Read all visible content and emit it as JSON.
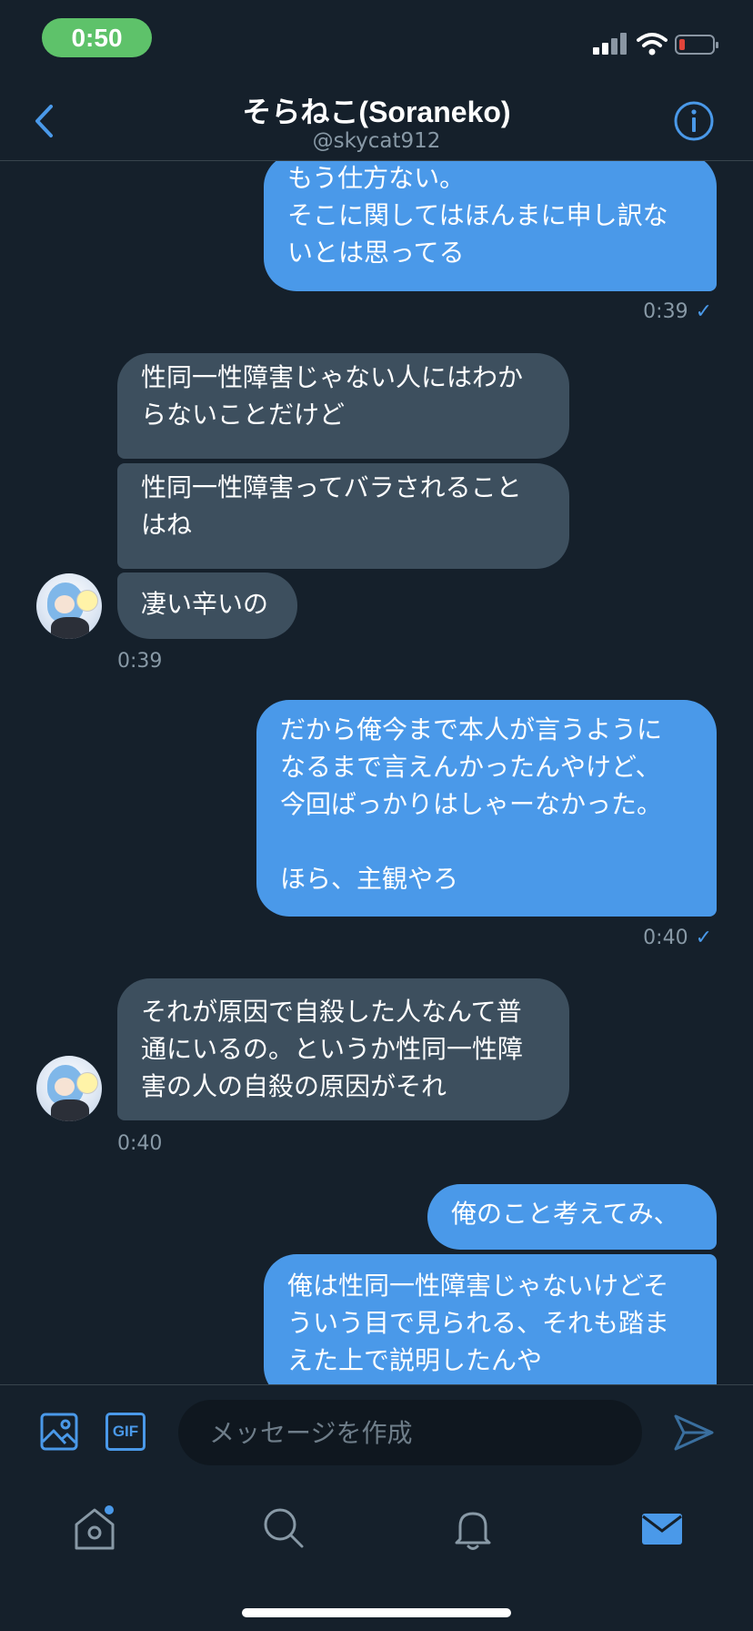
{
  "status_bar": {
    "time": "0:50"
  },
  "header": {
    "title": "そらねこ(Soraneko)",
    "handle": "@skycat912"
  },
  "messages": [
    {
      "id": "m1",
      "direction": "outgoing",
      "text": "もう仕方ない。\nそこに関してはほんまに申し訳ないとは思ってる"
    },
    {
      "id": "t1",
      "time": "0:39"
    },
    {
      "id": "m2",
      "direction": "incoming",
      "text": "性同一性障害じゃない人にはわからないことだけど"
    },
    {
      "id": "m3",
      "direction": "incoming",
      "text": "性同一性障害ってバラされることはね"
    },
    {
      "id": "m4",
      "direction": "incoming",
      "text": "凄い辛いの"
    },
    {
      "id": "t2",
      "time": "0:39"
    },
    {
      "id": "m5",
      "direction": "outgoing",
      "text": "だから俺今まで本人が言うようになるまで言えんかったんやけど、今回ばっかりはしゃーなかった。\n\nほら、主観やろ"
    },
    {
      "id": "t3",
      "time": "0:40"
    },
    {
      "id": "m6",
      "direction": "incoming",
      "text": "それが原因で自殺した人なんて普通にいるの。というか性同一性障害の人の自殺の原因がそれ"
    },
    {
      "id": "t4",
      "time": "0:40"
    },
    {
      "id": "m7",
      "direction": "outgoing",
      "text": "俺のこと考えてみ、"
    },
    {
      "id": "m8",
      "direction": "outgoing",
      "text": "俺は性同一性障害じゃないけどそういう目で見られる、それも踏まえた上で説明したんや"
    }
  ],
  "rendered_lines": {
    "m1": "もう仕方ない。\nそこに関してはほんまに申し訳な\nいとは思ってる",
    "m2": "性同一性障害じゃない人にはわか\nらないことだけど",
    "m3": "性同一性障害ってバラされること\nはね",
    "m5": "だから俺今まで本人が言うように\nなるまで言えんかったんやけど、\n今回ばっかりはしゃーなかった。\n\nほら、主観やろ",
    "m6": "それが原因で自殺した人なんて普\n通にいるの。というか性同一性障\n害の人の自殺の原因がそれ",
    "m8": "俺は性同一性障害じゃないけどそ\nういう目で見られる、それも踏ま\nえた上で説明したんや"
  },
  "composer": {
    "placeholder": "メッセージを作成",
    "gif_label": "GIF"
  },
  "icons": {
    "back": "chevron-left-icon",
    "info": "info-icon",
    "image": "image-icon",
    "send": "send-icon",
    "home": "home-icon",
    "search": "search-icon",
    "notifications": "bell-icon",
    "messages": "mail-icon"
  },
  "colors": {
    "background": "#15202b",
    "accent": "#4a99e9",
    "incoming_bubble": "#3d4f5e",
    "secondary_text": "#8899a6"
  }
}
